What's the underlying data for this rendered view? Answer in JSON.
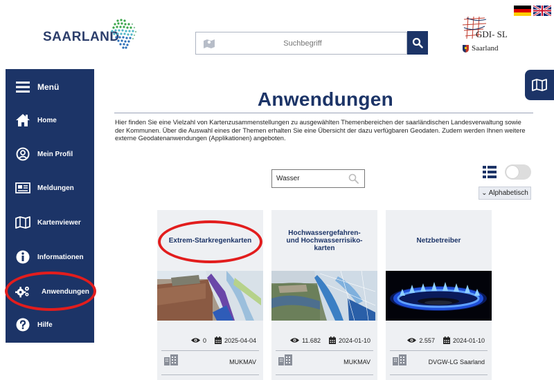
{
  "header": {
    "logo_text": "SAARLAND",
    "search_placeholder": "Suchbegriff",
    "gdi_title": "GDI- SL",
    "gdi_subtitle": "Saarland",
    "languages": [
      "de",
      "en"
    ]
  },
  "sidebar": {
    "menu_label": "Menü",
    "items": [
      {
        "label": "Home",
        "icon": "home-icon"
      },
      {
        "label": "Mein Profil",
        "icon": "user-circle-icon"
      },
      {
        "label": "Meldungen",
        "icon": "newspaper-icon"
      },
      {
        "label": "Kartenviewer",
        "icon": "map-icon"
      },
      {
        "label": "Informationen",
        "icon": "info-icon"
      },
      {
        "label": "Anwendungen",
        "icon": "gears-icon"
      },
      {
        "label": "Hilfe",
        "icon": "help-icon"
      }
    ],
    "active": "Anwendungen"
  },
  "main": {
    "title": "Anwendungen",
    "intro": "Hier finden Sie eine Vielzahl von Kartenzusammenstellungen zu ausgewählten Themenbereichen der saarländischen Landesverwaltung sowie der Kommunen. Über die Auswahl eines der Themen erhalten Sie eine Übersicht der dazu verfügbaren Geodaten. Zudem werden Ihnen weitere externe Geodatenanwendungen (Applikationen) angeboten.",
    "filter_value": "Wasser",
    "sort_label": "Alphabetisch"
  },
  "cards": [
    {
      "title": "Extrem-Starkregenkarten",
      "views": "0",
      "date": "2025-04-04",
      "owner": "MUKMAV"
    },
    {
      "title": "Hochwassergefahren- und Hochwasserrisiko- karten",
      "views": "11.682",
      "date": "2024-01-10",
      "owner": "MUKMAV"
    },
    {
      "title": "Netzbetreiber",
      "views": "2.557",
      "date": "2024-01-10",
      "owner": "DVGW-LG Saarland"
    }
  ],
  "colors": {
    "brand": "#1c3467",
    "highlight": "#e21d1d",
    "card_bg": "#eef0f3"
  }
}
